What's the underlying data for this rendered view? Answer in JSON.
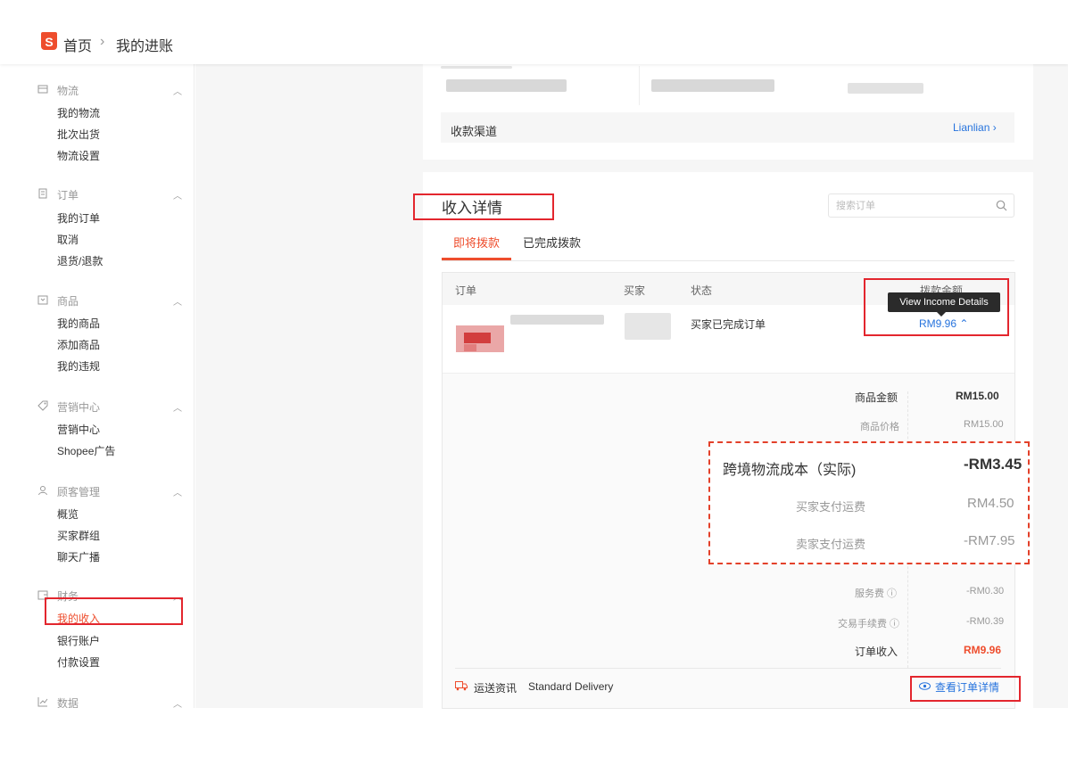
{
  "header": {
    "breadcrumb_home": "首页",
    "breadcrumb_sep": "›",
    "breadcrumb_current": "我的进账"
  },
  "sidebar": {
    "sections": [
      {
        "label": "物流",
        "icon": "truck-icon",
        "items": [
          "我的物流",
          "批次出货",
          "物流设置"
        ]
      },
      {
        "label": "订单",
        "icon": "order-icon",
        "items": [
          "我的订单",
          "取消",
          "退货/退款"
        ]
      },
      {
        "label": "商品",
        "icon": "product-icon",
        "items": [
          "我的商品",
          "添加商品",
          "我的违规"
        ]
      },
      {
        "label": "营销中心",
        "icon": "tag-icon",
        "items": [
          "营销中心",
          "Shopee广告"
        ]
      },
      {
        "label": "顾客管理",
        "icon": "user-icon",
        "items": [
          "概览",
          "买家群组",
          "聊天广播"
        ]
      },
      {
        "label": "财务",
        "icon": "wallet-icon",
        "items": [
          "我的收入",
          "银行账户",
          "付款设置"
        ],
        "active_item": "我的收入"
      },
      {
        "label": "数据",
        "icon": "chart-icon",
        "items": []
      }
    ]
  },
  "channel": {
    "label": "收款渠道",
    "value": "Lianlian ›"
  },
  "income": {
    "title": "收入详情",
    "search_placeholder": "搜索订单",
    "tabs": [
      "即将拨款",
      "已完成拨款"
    ],
    "columns": {
      "order": "订单",
      "buyer": "买家",
      "status": "状态",
      "amount": "拨款金额"
    },
    "row": {
      "status": "买家已完成订单",
      "amount": "RM9.96 ⌃"
    },
    "tooltip": "View Income Details",
    "breakdown": {
      "product_amount_label": "商品金额",
      "product_amount_value": "RM15.00",
      "product_price_label": "商品价格",
      "product_price_value": "RM15.00",
      "service_fee_label": "服务费 ⓘ",
      "service_fee_value": "-RM0.30",
      "transaction_fee_label": "交易手续费 ⓘ",
      "transaction_fee_value": "-RM0.39",
      "order_income_label": "订单收入",
      "order_income_value": "RM9.96"
    },
    "zoom": {
      "shipping_label": "跨境物流成本（实际)",
      "shipping_value": "-RM3.45",
      "buyer_paid_label": "买家支付运费",
      "buyer_paid_value": "RM4.50",
      "seller_paid_label": "卖家支付运费",
      "seller_paid_value": "-RM7.95"
    },
    "shipping_info_label": "运送资讯",
    "shipping_info_value": "Standard Delivery",
    "view_order_details": "查看订单详情"
  },
  "colors": {
    "brand": "#ee4d2d",
    "link": "#2673dd",
    "annotation": "#e3262e"
  }
}
